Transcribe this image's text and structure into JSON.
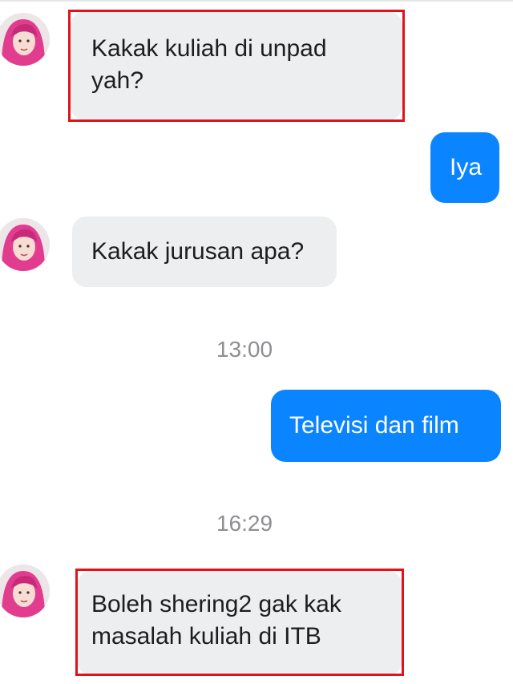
{
  "conversation": {
    "messages": [
      {
        "lines": [
          "Kakak kuliah di unpad",
          "yah?"
        ]
      },
      {
        "lines": [
          "Iya"
        ]
      },
      {
        "lines": [
          "Kakak jurusan apa?"
        ]
      },
      {
        "lines": [
          "Televisi dan film"
        ]
      },
      {
        "lines": [
          "Boleh shering2 gak kak",
          "masalah kuliah di ITB"
        ]
      }
    ],
    "timestamps": [
      "13:00",
      "16:29"
    ]
  },
  "colors": {
    "incoming_bubble": "#edeef0",
    "outgoing_bubble": "#0a84ff",
    "highlight_border": "#e0131c",
    "timestamp_text": "#8e8e93"
  },
  "icons": {
    "avatar": "contact-avatar-photo"
  }
}
